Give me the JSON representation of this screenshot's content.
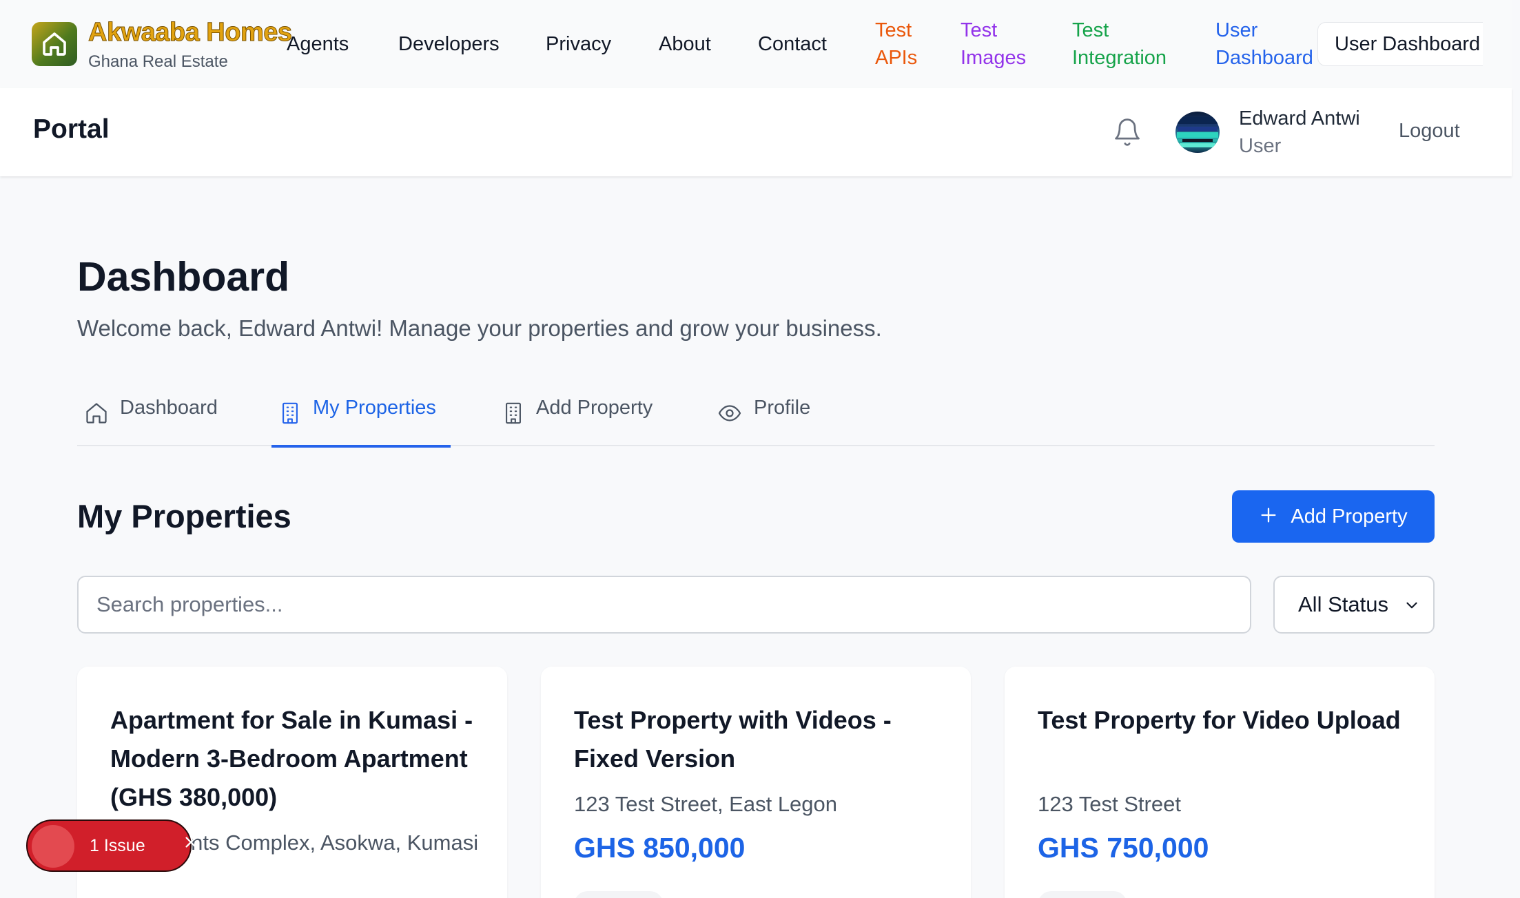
{
  "brand": {
    "name": "Akwaaba Homes",
    "tagline": "Ghana Real Estate"
  },
  "topnav": {
    "links": [
      "Agents",
      "Developers",
      "Privacy",
      "About",
      "Contact"
    ],
    "test_apis": [
      "Test",
      "APIs"
    ],
    "test_images": [
      "Test",
      "Images"
    ],
    "test_integration": [
      "Test",
      "Integration"
    ],
    "user_dashboard_link": [
      "User",
      "Dashboard"
    ],
    "user_dashboard_button": "User Dashboard"
  },
  "portal": {
    "title": "Portal",
    "user_name": "Edward Antwi",
    "user_role": "User",
    "logout": "Logout"
  },
  "page": {
    "title": "Dashboard",
    "subtitle": "Welcome back, Edward Antwi! Manage your properties and grow your business."
  },
  "tabs": [
    {
      "label": "Dashboard",
      "icon": "home-icon"
    },
    {
      "label": "My Properties",
      "icon": "building-icon",
      "active": true
    },
    {
      "label": "Add Property",
      "icon": "building-icon"
    },
    {
      "label": "Profile",
      "icon": "eye-icon"
    }
  ],
  "section": {
    "title": "My Properties",
    "add_button": "Add Property",
    "search_placeholder": "Search properties...",
    "status_filter": "All Status"
  },
  "properties": [
    {
      "title": "Apartment for Sale in Kumasi - Modern 3-Bedroom Apartment (GHS 380,000)",
      "location": "Apartments Complex, Asokwa, Kumasi",
      "price": ""
    },
    {
      "title": "Test Property with Videos - Fixed Version",
      "location": "123 Test Street, East Legon",
      "price": "GHS 850,000"
    },
    {
      "title": "Test Property for Video Upload",
      "location": "123 Test Street",
      "price": "GHS 750,000"
    }
  ],
  "issue_badge": {
    "label": "1 Issue"
  },
  "colors": {
    "accent": "#1a66f0",
    "test_apis": "#ea580c",
    "test_images": "#9333ea",
    "test_integration": "#16a34a",
    "user_dashboard": "#2563eb",
    "issue": "#d11f2a"
  }
}
